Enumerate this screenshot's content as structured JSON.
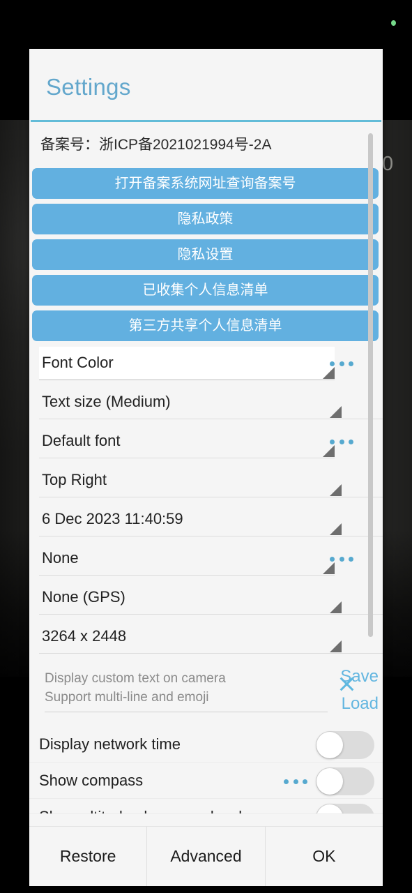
{
  "backdrop": {
    "rec_indicator": "recording-dot",
    "preview_counter": "0"
  },
  "dialog": {
    "title": "Settings",
    "legal_line": "备案号：浙ICP备2021021994号-2A",
    "link_buttons": [
      {
        "label": "打开备案系统网址查询备案号"
      },
      {
        "label": "隐私政策"
      },
      {
        "label": "隐私设置"
      },
      {
        "label": "已收集个人信息清单"
      },
      {
        "label": "第三方共享个人信息清单"
      }
    ],
    "spinners": [
      {
        "value": "Font Color",
        "style": "white",
        "has_overflow": true
      },
      {
        "value": "Text size (Medium)",
        "style": "wide",
        "has_overflow": false
      },
      {
        "value": "Default font",
        "style": "narrow",
        "has_overflow": true
      },
      {
        "value": "Top Right",
        "style": "wide",
        "has_overflow": false
      },
      {
        "value": "6 Dec 2023 11:40:59",
        "style": "wide",
        "has_overflow": false
      },
      {
        "value": "None",
        "style": "narrow",
        "has_overflow": true
      },
      {
        "value": "None (GPS)",
        "style": "wide",
        "has_overflow": false
      },
      {
        "value": "3264 x 2448",
        "style": "wide",
        "has_overflow": false
      }
    ],
    "custom_text": {
      "value": "",
      "placeholder": "Display custom text on camera\nSupport multi-line and emoji",
      "clear_icon": "close-icon",
      "save_label": "Save",
      "load_label": "Load"
    },
    "toggles": [
      {
        "label": "Display network time",
        "checked": false,
        "has_overflow": false
      },
      {
        "label": "Show compass",
        "checked": false,
        "has_overflow": true
      },
      {
        "label": "Show altitude above sea level",
        "checked": false,
        "has_overflow": false
      }
    ],
    "buttons": {
      "restore": "Restore",
      "advanced": "Advanced",
      "ok": "OK"
    }
  },
  "colors": {
    "accent_blue": "#62b0e0",
    "title_blue": "#63a7cc",
    "divider_blue": "#63bcd8",
    "link_blue": "#63b6e0",
    "dialog_bg": "#f5f5f5",
    "rec_green": "#76d98a"
  }
}
